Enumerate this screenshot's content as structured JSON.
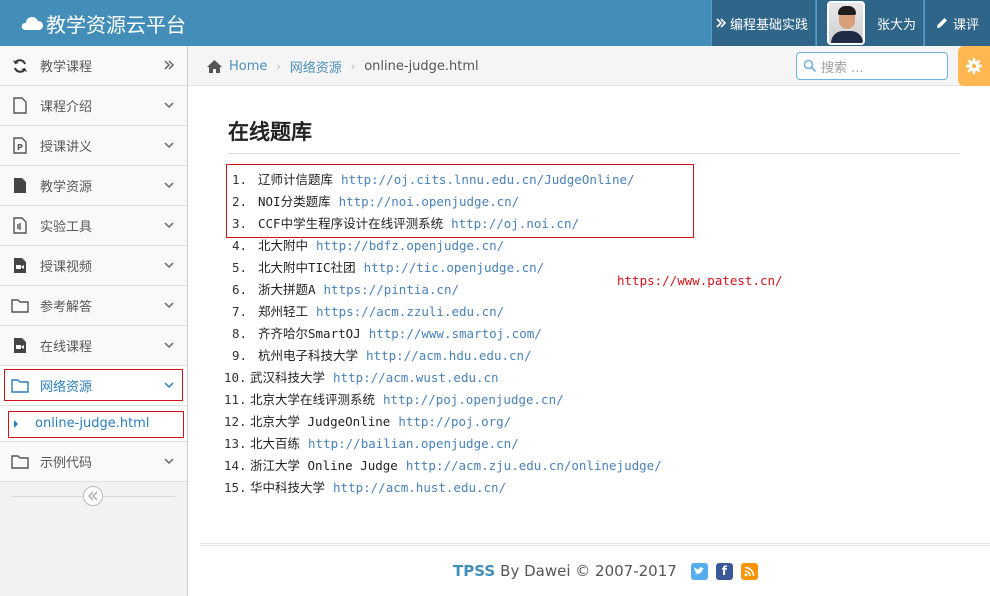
{
  "navbar": {
    "brand": "教学资源云平台",
    "practice": "编程基础实践",
    "user_name": "张大为",
    "review": "课评"
  },
  "sidebar": {
    "items": [
      {
        "label": "教学课程",
        "icon": "refresh-icon",
        "chevron": "double-right"
      },
      {
        "label": "课程介绍",
        "icon": "file-icon",
        "chevron": "down"
      },
      {
        "label": "授课讲义",
        "icon": "powerpoint-file-icon",
        "chevron": "down"
      },
      {
        "label": "教学资源",
        "icon": "file-filled-icon",
        "chevron": "down"
      },
      {
        "label": "实验工具",
        "icon": "tool-file-icon",
        "chevron": "down"
      },
      {
        "label": "授课视频",
        "icon": "video-file-icon",
        "chevron": "down"
      },
      {
        "label": "参考解答",
        "icon": "folder-icon",
        "chevron": "down"
      },
      {
        "label": "在线课程",
        "icon": "video-file-icon",
        "chevron": "down"
      },
      {
        "label": "网络资源",
        "icon": "folder-icon",
        "chevron": "down"
      },
      {
        "label": "示例代码",
        "icon": "folder-icon",
        "chevron": "down"
      }
    ],
    "sub_item": "online-judge.html",
    "collapse_icon": "double-left-icon"
  },
  "breadcrumb": {
    "home": "Home",
    "section": "网络资源",
    "current": "online-judge.html"
  },
  "search": {
    "placeholder": "搜索 ..."
  },
  "main": {
    "title": "在线题库",
    "links": [
      {
        "num": "1.",
        "name": "辽师计信题库",
        "url": "http://oj.cits.lnnu.edu.cn/JudgeOnline/"
      },
      {
        "num": "2.",
        "name": "NOI分类题库",
        "url": "http://noi.openjudge.cn/"
      },
      {
        "num": "3.",
        "name": "CCF中学生程序设计在线评测系统",
        "url": "http://oj.noi.cn/"
      },
      {
        "num": "4.",
        "name": "北大附中",
        "url": "http://bdfz.openjudge.cn/"
      },
      {
        "num": "5.",
        "name": "北大附中TIC社团",
        "url": "http://tic.openjudge.cn/"
      },
      {
        "num": "6.",
        "name": "浙大拼题A",
        "url": "https://pintia.cn/"
      },
      {
        "num": "7.",
        "name": "郑州轻工",
        "url": "https://acm.zzuli.edu.cn/"
      },
      {
        "num": "8.",
        "name": "齐齐哈尔SmartOJ",
        "url": "http://www.smartoj.com/"
      },
      {
        "num": "9.",
        "name": "杭州电子科技大学",
        "url": "http://acm.hdu.edu.cn/"
      },
      {
        "num": "10.",
        "name": "武汉科技大学",
        "url": "http://acm.wust.edu.cn"
      },
      {
        "num": "11.",
        "name": "北京大学在线评测系统",
        "url": "http://poj.openjudge.cn/"
      },
      {
        "num": "12.",
        "name": "北京大学 JudgeOnline",
        "url": "http://poj.org/"
      },
      {
        "num": "13.",
        "name": "北大百练",
        "url": "http://bailian.openjudge.cn/"
      },
      {
        "num": "14.",
        "name": "浙江大学 Online Judge",
        "url": "http://acm.zju.edu.cn/onlinejudge/"
      },
      {
        "num": "15.",
        "name": "华中科技大学",
        "url": "http://acm.hust.edu.cn/"
      }
    ],
    "annotation": "https://www.patest.cn/"
  },
  "footer": {
    "brand": "TPSS",
    "text": "By Dawei © 2007-2017"
  },
  "colors": {
    "navbar": "#438eb9",
    "accent": "#2b7dbc",
    "highlight_border": "#d0141a",
    "settings": "#ffb752"
  }
}
